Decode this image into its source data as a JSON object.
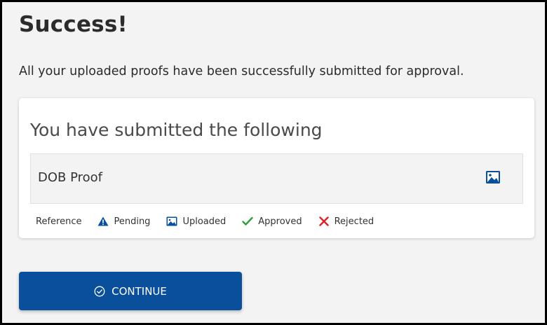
{
  "page": {
    "title": "Success!",
    "message": "All your uploaded proofs have been successfully submitted for approval."
  },
  "card": {
    "heading": "You have submitted the following",
    "proofs": [
      {
        "name": "DOB Proof",
        "status_icon": "image-icon"
      }
    ]
  },
  "legend": {
    "reference": "Reference",
    "items": [
      {
        "label": "Pending",
        "icon": "warning-triangle-icon",
        "color": "#0a4f9c"
      },
      {
        "label": "Uploaded",
        "icon": "image-icon",
        "color": "#0a4f9c"
      },
      {
        "label": "Approved",
        "icon": "checkmark-icon",
        "color": "#2e9e3e"
      },
      {
        "label": "Rejected",
        "icon": "x-icon",
        "color": "#e02020"
      }
    ]
  },
  "continue_button": {
    "label": "CONTINUE",
    "icon": "circle-check-icon",
    "color": "#0a4f9c"
  }
}
